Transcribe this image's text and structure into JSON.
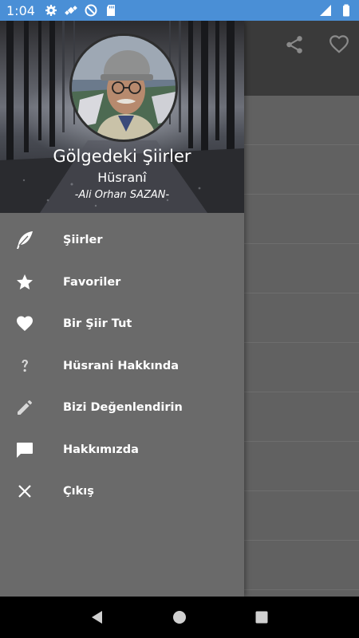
{
  "status_bar": {
    "time": "1:04",
    "left_icons": [
      "gear-icon",
      "satellite-icon",
      "no-data-icon",
      "sd-card-icon"
    ],
    "right_icons": [
      "signal-icon",
      "battery-icon"
    ]
  },
  "app_toolbar": {
    "actions": [
      "share-icon",
      "heart-outline-icon"
    ]
  },
  "drawer": {
    "title": "Gölgedeki Şiirler",
    "subtitle": "Hüsranî",
    "author": "-Ali Orhan SAZAN-",
    "menu": [
      {
        "label": "Şiirler",
        "icon": "feather-icon"
      },
      {
        "label": "Favoriler",
        "icon": "star-icon"
      },
      {
        "label": "Bir Şiir Tut",
        "icon": "heart-icon"
      },
      {
        "label": "Hüsrani Hakkında",
        "icon": "question-icon"
      },
      {
        "label": "Bizi Değenlendirin",
        "icon": "pencil-icon"
      },
      {
        "label": "Hakkımızda",
        "icon": "chat-icon"
      },
      {
        "label": "Çıkış",
        "icon": "close-icon"
      }
    ]
  },
  "nav_bar": {
    "buttons": [
      "back-icon",
      "home-icon",
      "recents-icon"
    ]
  },
  "colors": {
    "status_bar": "#4a8fd6",
    "drawer_bg": "#6a6a6a",
    "toolbar": "#3a3a3a",
    "app_bg": "#616161"
  }
}
